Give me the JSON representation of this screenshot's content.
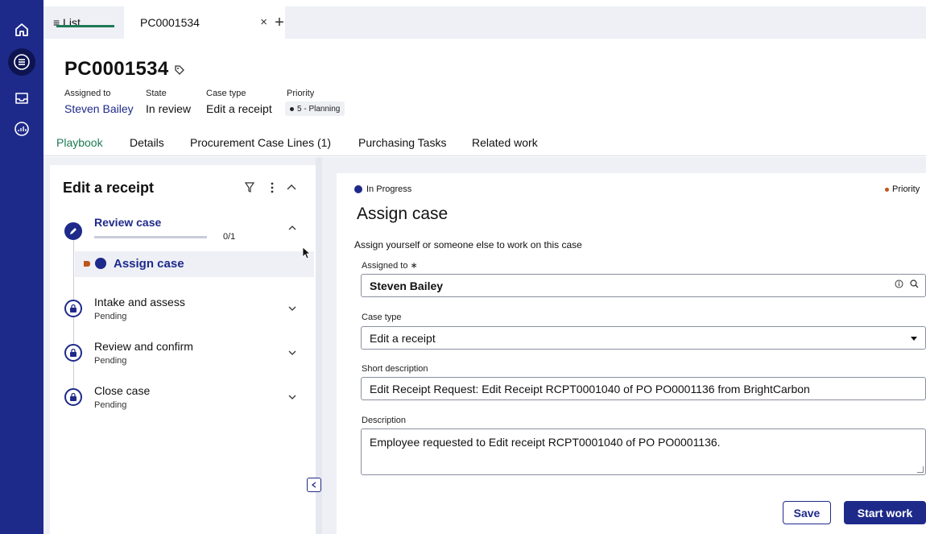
{
  "rail": {
    "icons": [
      "home-icon",
      "list-icon",
      "inbox-icon",
      "dashboard-icon"
    ]
  },
  "tabbar": {
    "list_label": "≡ List",
    "case_tab_label": "PC0001534",
    "close_glyph": "×",
    "add_glyph": "+"
  },
  "header": {
    "case_id": "PC0001534",
    "meta": {
      "assigned_to_label": "Assigned to",
      "assigned_to_value": "Steven Bailey",
      "state_label": "State",
      "state_value": "In review",
      "case_type_label": "Case type",
      "case_type_value": "Edit a receipt",
      "priority_label": "Priority",
      "priority_value": "5 - Planning"
    }
  },
  "nav": {
    "tabs": [
      "Playbook",
      "Details",
      "Procurement Case Lines (1)",
      "Purchasing Tasks",
      "Related work"
    ],
    "active": "Playbook"
  },
  "playbook": {
    "title": "Edit a receipt",
    "stages": [
      {
        "name": "Review case",
        "status": "",
        "progress_text": "0/1",
        "progress": 0
      },
      {
        "name": "Intake and assess",
        "status": "Pending"
      },
      {
        "name": "Review and confirm",
        "status": "Pending"
      },
      {
        "name": "Close case",
        "status": "Pending"
      }
    ],
    "active_step": "Assign case"
  },
  "form": {
    "status": "In Progress",
    "priority_label": "Priority",
    "title": "Assign case",
    "instruction": "Assign yourself or someone else to work on this case",
    "assigned_to_label": "Assigned to ∗",
    "assigned_to_value": "Steven Bailey",
    "case_type_label": "Case type",
    "case_type_value": "Edit a receipt",
    "short_desc_label": "Short description",
    "short_desc_value": "Edit Receipt Request: Edit Receipt RCPT0001040 of PO PO0001136 from BrightCarbon",
    "desc_label": "Description",
    "desc_value": "Employee requested to Edit receipt RCPT0001040 of PO PO0001136.",
    "save_label": "Save",
    "start_label": "Start work"
  },
  "colors": {
    "brand": "#1e2a8a",
    "active_tab": "#1e7a55",
    "priority_dot": "#c0561a"
  }
}
